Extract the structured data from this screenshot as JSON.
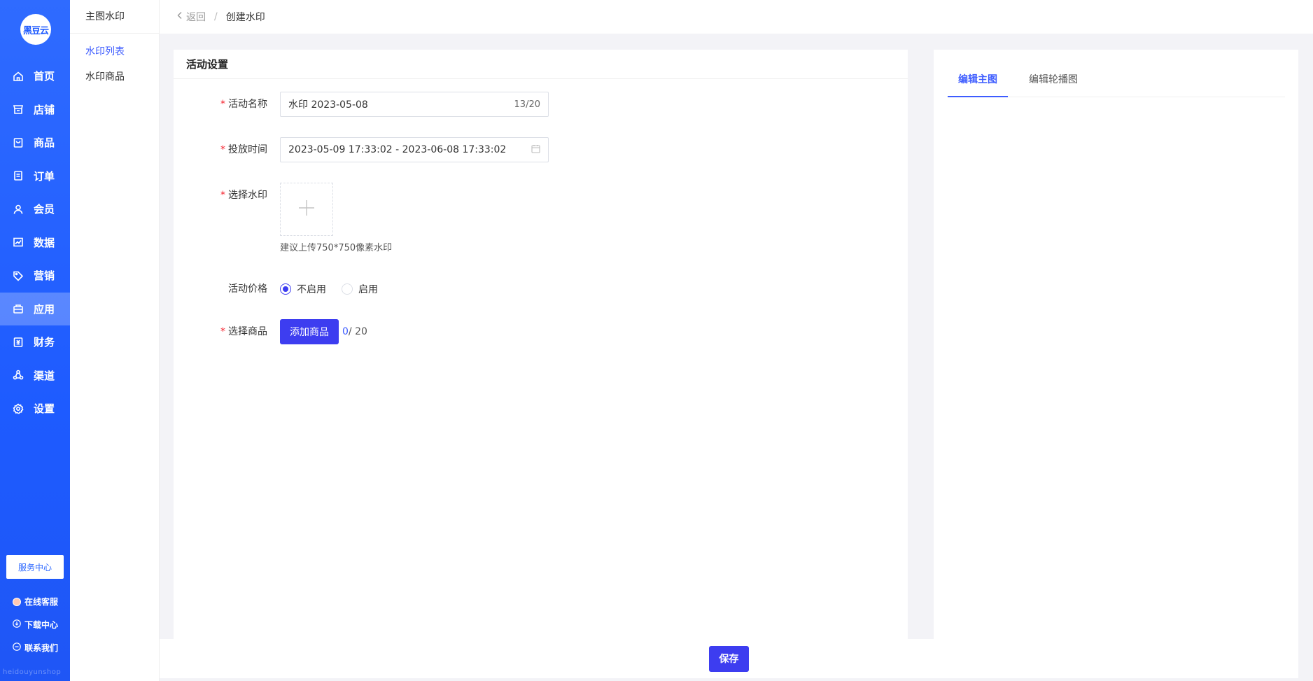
{
  "sidebar": {
    "logo_text": "黑豆云",
    "items": [
      {
        "label": "首页",
        "icon": "home-icon"
      },
      {
        "label": "店铺",
        "icon": "store-icon"
      },
      {
        "label": "商品",
        "icon": "goods-icon"
      },
      {
        "label": "订单",
        "icon": "order-icon"
      },
      {
        "label": "会员",
        "icon": "member-icon"
      },
      {
        "label": "数据",
        "icon": "chart-icon"
      },
      {
        "label": "营销",
        "icon": "tag-icon"
      },
      {
        "label": "应用",
        "icon": "app-icon"
      },
      {
        "label": "财务",
        "icon": "finance-icon"
      },
      {
        "label": "渠道",
        "icon": "channel-icon"
      },
      {
        "label": "设置",
        "icon": "gear-icon"
      }
    ],
    "active_item": "应用",
    "service_center": "服务中心",
    "links": [
      {
        "label": "在线客服"
      },
      {
        "label": "下载中心"
      },
      {
        "label": "联系我们"
      }
    ],
    "brand_footer": "heidouyunshop"
  },
  "submenu": {
    "title": "主图水印",
    "items": [
      {
        "label": "水印列表",
        "active": true
      },
      {
        "label": "水印商品",
        "active": false
      }
    ]
  },
  "breadcrumb": {
    "back": "返回",
    "separator": "/",
    "current": "创建水印"
  },
  "form": {
    "section_title": "活动设置",
    "name": {
      "label": "活动名称",
      "value": "水印 2023-05-08",
      "count": "13/20"
    },
    "time": {
      "label": "投放时间",
      "value": "2023-05-09 17:33:02 - 2023-06-08 17:33:02"
    },
    "watermark": {
      "label": "选择水印",
      "hint": "建议上传750*750像素水印"
    },
    "price": {
      "label": "活动价格",
      "options": [
        "不启用",
        "启用"
      ],
      "selected": "不启用"
    },
    "goods": {
      "label": "选择商品",
      "button": "添加商品",
      "count_current": "0",
      "count_total": "/ 20"
    }
  },
  "preview": {
    "tabs": [
      {
        "label": "编辑主图",
        "active": true
      },
      {
        "label": "编辑轮播图",
        "active": false
      }
    ]
  },
  "actions": {
    "save": "保存"
  },
  "colors": {
    "sidebar": "#2f6bff",
    "primary": "#3d3df0",
    "link": "#3d5cff",
    "required": "#f5222d"
  }
}
